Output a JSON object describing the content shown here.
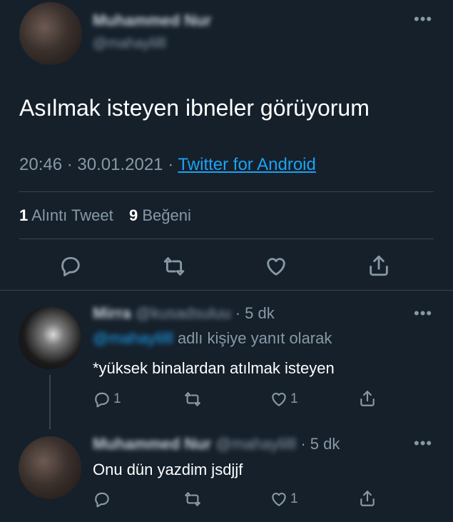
{
  "main_tweet": {
    "author_name": "Muhammed Nur",
    "author_handle": "@mahaylilll",
    "text": "Asılmak isteyen ibneler görüyorum",
    "time": "20:46",
    "separator": "·",
    "date": "30.01.2021",
    "source": "Twitter for Android",
    "stats": {
      "quote_count": "1",
      "quote_label": "Alıntı Tweet",
      "like_count": "9",
      "like_label": "Beğeni"
    },
    "actions": [
      "reply-icon",
      "retweet-icon",
      "like-icon",
      "share-icon"
    ]
  },
  "replies": [
    {
      "author_name": "Mirra",
      "author_handle": "@kusadsuluu",
      "time": "5 dk",
      "replying_to_handle": "@mahaylilll",
      "replying_to_text": "adlı kişiye yanıt olarak",
      "text": "*yüksek binalardan atılmak isteyen",
      "reply_count": "1",
      "like_count": "1"
    },
    {
      "author_name": "Muhammed Nur",
      "author_handle": "@mahaylilll",
      "time": "5 dk",
      "text": "Onu dün yazdim jsdjjf",
      "like_count": "1"
    }
  ],
  "colors": {
    "background": "#15202b",
    "text": "#ffffff",
    "secondary": "#8899a6",
    "link": "#1da1f2",
    "divider": "#38444d"
  }
}
